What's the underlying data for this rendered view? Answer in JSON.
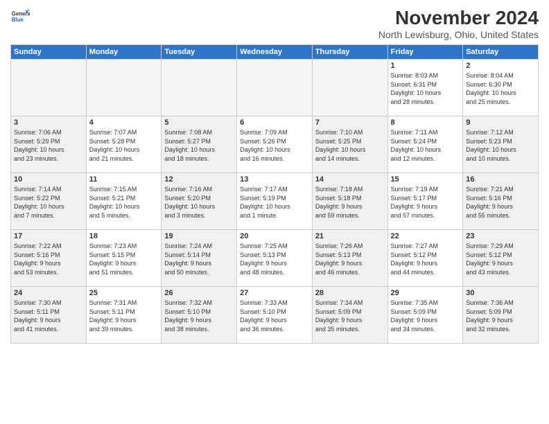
{
  "logo": {
    "line1": "General",
    "line2": "Blue"
  },
  "title": "November 2024",
  "location": "North Lewisburg, Ohio, United States",
  "weekdays": [
    "Sunday",
    "Monday",
    "Tuesday",
    "Wednesday",
    "Thursday",
    "Friday",
    "Saturday"
  ],
  "weeks": [
    [
      {
        "day": "",
        "empty": true
      },
      {
        "day": "",
        "empty": true
      },
      {
        "day": "",
        "empty": true
      },
      {
        "day": "",
        "empty": true
      },
      {
        "day": "",
        "empty": true
      },
      {
        "day": "1",
        "lines": [
          "Sunrise: 8:03 AM",
          "Sunset: 6:31 PM",
          "Daylight: 10 hours",
          "and 28 minutes."
        ]
      },
      {
        "day": "2",
        "lines": [
          "Sunrise: 8:04 AM",
          "Sunset: 6:30 PM",
          "Daylight: 10 hours",
          "and 25 minutes."
        ]
      }
    ],
    [
      {
        "day": "3",
        "shaded": true,
        "lines": [
          "Sunrise: 7:06 AM",
          "Sunset: 5:29 PM",
          "Daylight: 10 hours",
          "and 23 minutes."
        ]
      },
      {
        "day": "4",
        "lines": [
          "Sunrise: 7:07 AM",
          "Sunset: 5:28 PM",
          "Daylight: 10 hours",
          "and 21 minutes."
        ]
      },
      {
        "day": "5",
        "shaded": true,
        "lines": [
          "Sunrise: 7:08 AM",
          "Sunset: 5:27 PM",
          "Daylight: 10 hours",
          "and 18 minutes."
        ]
      },
      {
        "day": "6",
        "lines": [
          "Sunrise: 7:09 AM",
          "Sunset: 5:26 PM",
          "Daylight: 10 hours",
          "and 16 minutes."
        ]
      },
      {
        "day": "7",
        "shaded": true,
        "lines": [
          "Sunrise: 7:10 AM",
          "Sunset: 5:25 PM",
          "Daylight: 10 hours",
          "and 14 minutes."
        ]
      },
      {
        "day": "8",
        "lines": [
          "Sunrise: 7:11 AM",
          "Sunset: 5:24 PM",
          "Daylight: 10 hours",
          "and 12 minutes."
        ]
      },
      {
        "day": "9",
        "shaded": true,
        "lines": [
          "Sunrise: 7:12 AM",
          "Sunset: 5:23 PM",
          "Daylight: 10 hours",
          "and 10 minutes."
        ]
      }
    ],
    [
      {
        "day": "10",
        "shaded": true,
        "lines": [
          "Sunrise: 7:14 AM",
          "Sunset: 5:22 PM",
          "Daylight: 10 hours",
          "and 7 minutes."
        ]
      },
      {
        "day": "11",
        "lines": [
          "Sunrise: 7:15 AM",
          "Sunset: 5:21 PM",
          "Daylight: 10 hours",
          "and 5 minutes."
        ]
      },
      {
        "day": "12",
        "shaded": true,
        "lines": [
          "Sunrise: 7:16 AM",
          "Sunset: 5:20 PM",
          "Daylight: 10 hours",
          "and 3 minutes."
        ]
      },
      {
        "day": "13",
        "lines": [
          "Sunrise: 7:17 AM",
          "Sunset: 5:19 PM",
          "Daylight: 10 hours",
          "and 1 minute."
        ]
      },
      {
        "day": "14",
        "shaded": true,
        "lines": [
          "Sunrise: 7:18 AM",
          "Sunset: 5:18 PM",
          "Daylight: 9 hours",
          "and 59 minutes."
        ]
      },
      {
        "day": "15",
        "lines": [
          "Sunrise: 7:19 AM",
          "Sunset: 5:17 PM",
          "Daylight: 9 hours",
          "and 57 minutes."
        ]
      },
      {
        "day": "16",
        "shaded": true,
        "lines": [
          "Sunrise: 7:21 AM",
          "Sunset: 5:16 PM",
          "Daylight: 9 hours",
          "and 55 minutes."
        ]
      }
    ],
    [
      {
        "day": "17",
        "shaded": true,
        "lines": [
          "Sunrise: 7:22 AM",
          "Sunset: 5:16 PM",
          "Daylight: 9 hours",
          "and 53 minutes."
        ]
      },
      {
        "day": "18",
        "lines": [
          "Sunrise: 7:23 AM",
          "Sunset: 5:15 PM",
          "Daylight: 9 hours",
          "and 51 minutes."
        ]
      },
      {
        "day": "19",
        "shaded": true,
        "lines": [
          "Sunrise: 7:24 AM",
          "Sunset: 5:14 PM",
          "Daylight: 9 hours",
          "and 50 minutes."
        ]
      },
      {
        "day": "20",
        "lines": [
          "Sunrise: 7:25 AM",
          "Sunset: 5:13 PM",
          "Daylight: 9 hours",
          "and 48 minutes."
        ]
      },
      {
        "day": "21",
        "shaded": true,
        "lines": [
          "Sunrise: 7:26 AM",
          "Sunset: 5:13 PM",
          "Daylight: 9 hours",
          "and 46 minutes."
        ]
      },
      {
        "day": "22",
        "lines": [
          "Sunrise: 7:27 AM",
          "Sunset: 5:12 PM",
          "Daylight: 9 hours",
          "and 44 minutes."
        ]
      },
      {
        "day": "23",
        "shaded": true,
        "lines": [
          "Sunrise: 7:29 AM",
          "Sunset: 5:12 PM",
          "Daylight: 9 hours",
          "and 43 minutes."
        ]
      }
    ],
    [
      {
        "day": "24",
        "shaded": true,
        "lines": [
          "Sunrise: 7:30 AM",
          "Sunset: 5:11 PM",
          "Daylight: 9 hours",
          "and 41 minutes."
        ]
      },
      {
        "day": "25",
        "lines": [
          "Sunrise: 7:31 AM",
          "Sunset: 5:11 PM",
          "Daylight: 9 hours",
          "and 39 minutes."
        ]
      },
      {
        "day": "26",
        "shaded": true,
        "lines": [
          "Sunrise: 7:32 AM",
          "Sunset: 5:10 PM",
          "Daylight: 9 hours",
          "and 38 minutes."
        ]
      },
      {
        "day": "27",
        "lines": [
          "Sunrise: 7:33 AM",
          "Sunset: 5:10 PM",
          "Daylight: 9 hours",
          "and 36 minutes."
        ]
      },
      {
        "day": "28",
        "shaded": true,
        "lines": [
          "Sunrise: 7:34 AM",
          "Sunset: 5:09 PM",
          "Daylight: 9 hours",
          "and 35 minutes."
        ]
      },
      {
        "day": "29",
        "lines": [
          "Sunrise: 7:35 AM",
          "Sunset: 5:09 PM",
          "Daylight: 9 hours",
          "and 34 minutes."
        ]
      },
      {
        "day": "30",
        "shaded": true,
        "lines": [
          "Sunrise: 7:36 AM",
          "Sunset: 5:09 PM",
          "Daylight: 9 hours",
          "and 32 minutes."
        ]
      }
    ]
  ]
}
